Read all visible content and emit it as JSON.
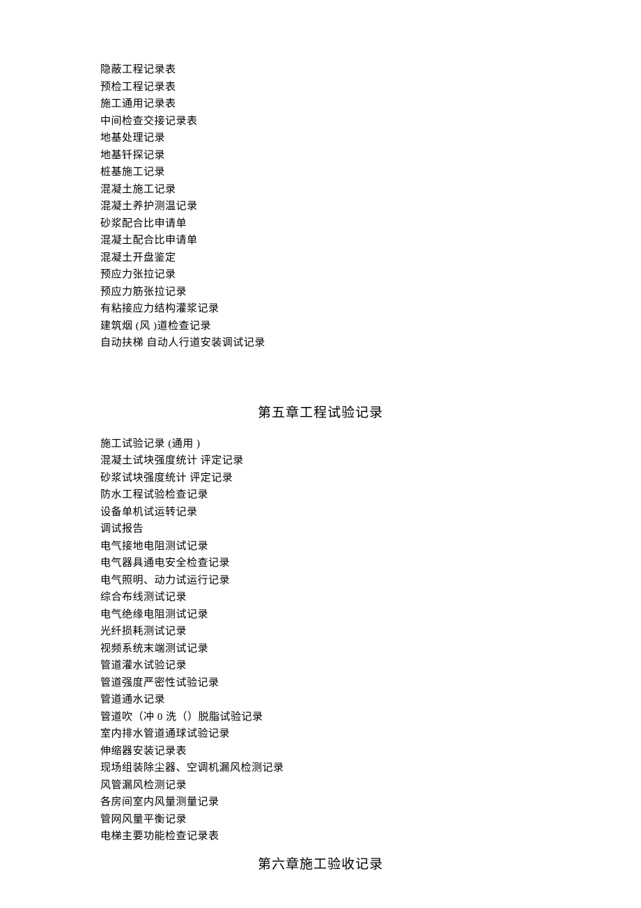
{
  "section1": {
    "items": [
      "隐蔽工程记录表",
      "预检工程记录表",
      "施工通用记录表",
      "中间检查交接记录表",
      "地基处理记录",
      "地基钎探记录",
      "桩基施工记录",
      "混凝土施工记录",
      "混凝土养护测温记录",
      "砂浆配合比申请单",
      "混凝土配合比申请单",
      "混凝土开盘鉴定",
      "预应力张拉记录",
      "预应力筋张拉记录",
      "有粘接应力结构灌浆记录",
      "建筑烟 (风 )道检查记录",
      "自动扶梯   自动人行道安装调试记录"
    ]
  },
  "chapter5": {
    "title": "第五章工程试验记录",
    "items": [
      "施工试验记录  (通用 )",
      "混凝土试块强度统计     评定记录",
      "砂浆试块强度统计     评定记录",
      "防水工程试验检查记录",
      "设备单机试运转记录",
      "调试报告",
      "电气接地电阻测试记录",
      "电气器具通电安全检查记录",
      "电气照明、动力试运行记录",
      "综合布线测试记录",
      "电气绝缘电阻测试记录",
      "光纤损耗测试记录",
      "视频系统末端测试记录",
      "管道灌水试验记录",
      "管道强度严密性试验记录",
      "管道通水记录",
      "管道吹（冲   0 洗（）脱脂试验记录",
      "室内排水管道通球试验记录",
      "伸缩器安装记录表",
      "现场组装除尘器、空调机漏风检测记录",
      "风管漏风检测记录",
      "各房间室内风量测量记录",
      "管网风量平衡记录",
      "电梯主要功能检查记录表"
    ]
  },
  "chapter6": {
    "title": "第六章施工验收记录"
  }
}
